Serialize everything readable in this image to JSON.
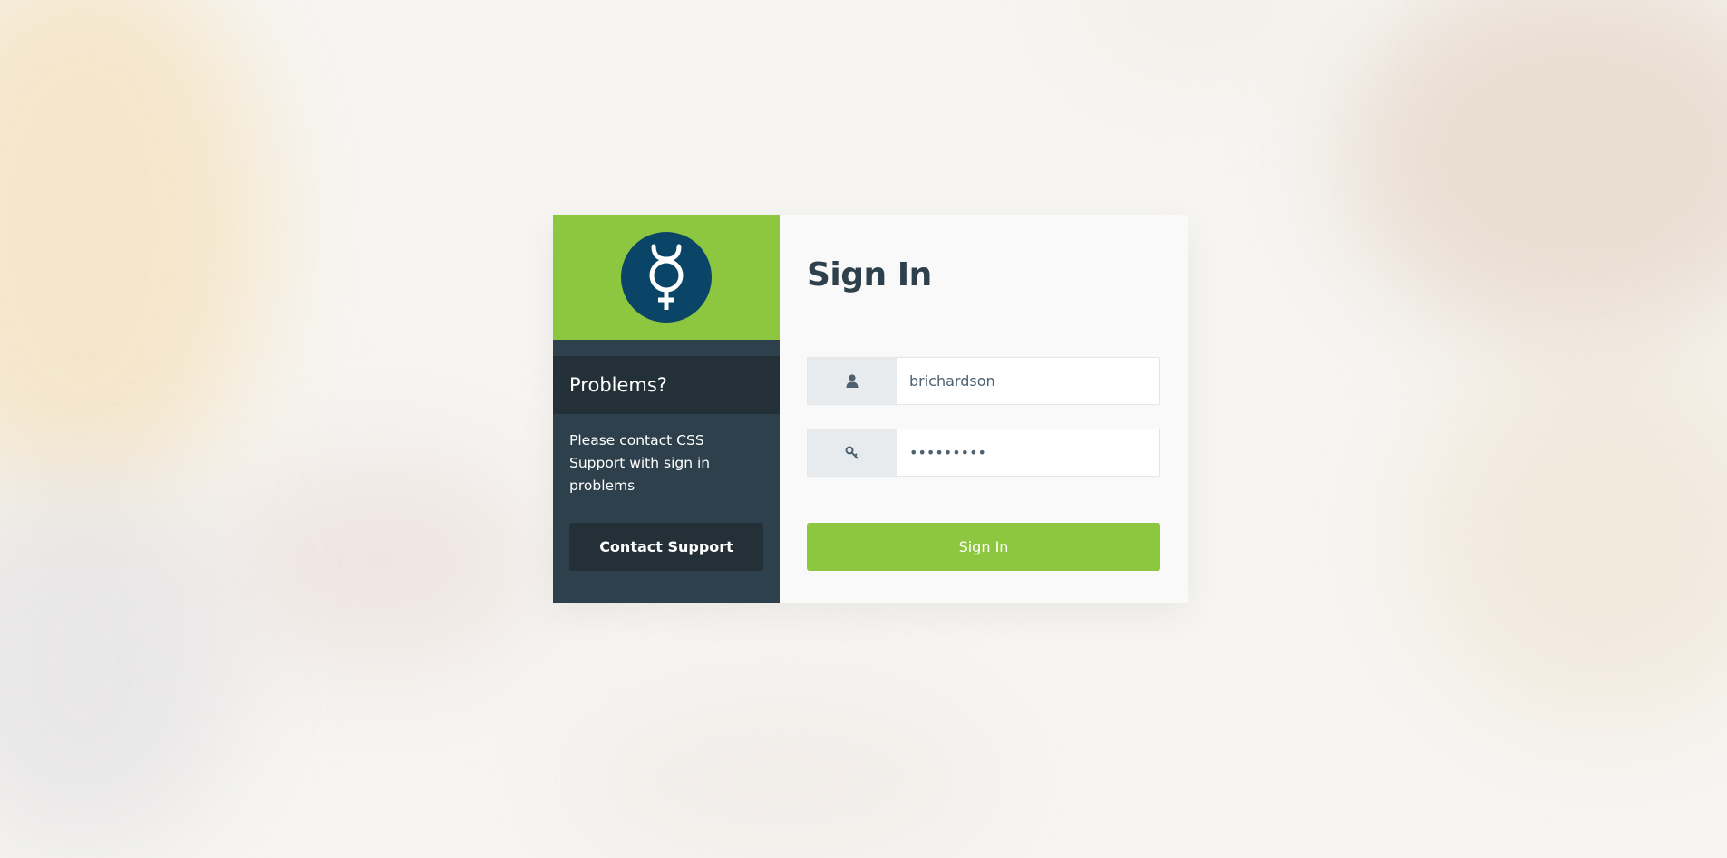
{
  "colors": {
    "accent_green": "#8dc63f",
    "sidebar_dark": "#2e404b",
    "sidebar_darker": "#233038",
    "logo_blue": "#0a4466"
  },
  "logo": {
    "icon": "mercury-symbol-icon"
  },
  "sidebar": {
    "heading": "Problems?",
    "message": "Please contact CSS Support with sign in problems",
    "contact_button_label": "Contact Support"
  },
  "form": {
    "title": "Sign In",
    "username": {
      "icon": "user-icon",
      "value": "brichardson"
    },
    "password": {
      "icon": "key-icon",
      "value": "•••••••••"
    },
    "submit_label": "Sign In"
  }
}
